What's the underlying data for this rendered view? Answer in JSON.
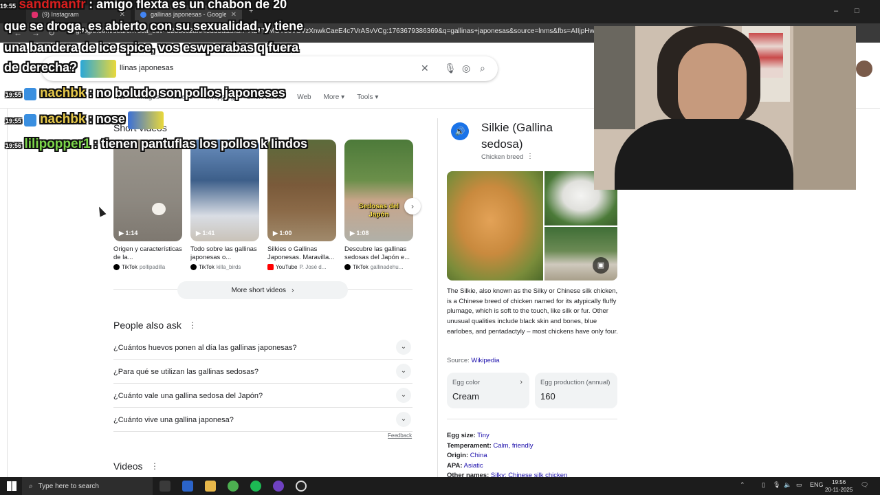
{
  "browser": {
    "tabs": [
      {
        "label": "(9) Instagram",
        "active": false
      },
      {
        "label": "gallinas japonesas - Google Se",
        "active": true
      }
    ],
    "url": "google.com/search?sca_esv=323dcc2af045d35a&sxsrf=AE3TifMOT50VSVzXnwkCaeE4c7VrASvVCg:1763679386369&q=gallinas+japonesas&source=lnms&fbs=AIIjpHw5jcGp5x8w5sPu",
    "new_tab": "+"
  },
  "search": {
    "query": "gallinas japonesas",
    "query_visible": "llinas japonesas",
    "filters": [
      "All",
      "Images",
      "Videos",
      "Shopping",
      "Short videos",
      "Web",
      "More",
      "Tools"
    ]
  },
  "short_videos": {
    "title": "Short videos",
    "more_label": "More short videos",
    "items": [
      {
        "duration": "1:14",
        "caption": "Origen y características de la...",
        "platform": "TikTok",
        "author": "pollipadilla",
        "color": "#000000"
      },
      {
        "duration": "1:41",
        "caption": "Todo sobre las gallinas japonesas o...",
        "platform": "TikTok",
        "author": "killa_birds",
        "color": "#000000"
      },
      {
        "duration": "1:00",
        "caption": "Silkies o Gallinas Japonesas. Maravilla...",
        "platform": "YouTube",
        "author": "P. José d...",
        "color": "#ff0000"
      },
      {
        "duration": "1:08",
        "caption": "Descubre las gallinas sedosas del Japón e...",
        "platform": "TikTok",
        "author": "gallinadehu...",
        "color": "#000000",
        "overlay_text": "Sedosas del Japón"
      }
    ]
  },
  "people_also_ask": {
    "title": "People also ask",
    "questions": [
      "¿Cuántos huevos ponen al día las gallinas japonesas?",
      "¿Para qué se utilizan las gallinas sedosas?",
      "¿Cuánto vale una gallina sedosa del Japón?",
      "¿Cuánto vive una gallina japonesa?"
    ],
    "feedback": "Feedback"
  },
  "videos_title": "Videos",
  "knowledge_panel": {
    "title": "Silkie (Gallina sedosa)",
    "subtitle": "Chicken breed",
    "description": "The Silkie, also known as the Silky or Chinese silk chicken, is a Chinese breed of chicken named for its atypically fluffy plumage, which is soft to the touch, like silk or fur. Other unusual qualities include black skin and bones, blue earlobes, and pentadactyly – most chickens have only four.",
    "source_label": "Source:",
    "source_link": "Wikipedia",
    "facts": [
      {
        "label": "Egg color",
        "value": "Cream"
      },
      {
        "label": "Egg production (annual)",
        "value": "160"
      }
    ],
    "attributes": [
      {
        "key": "Egg size:",
        "value": "Tiny"
      },
      {
        "key": "Temperament:",
        "value": "Calm, friendly"
      },
      {
        "key": "Origin:",
        "value": "China"
      },
      {
        "key": "APA:",
        "value": "Asiatic"
      },
      {
        "key": "Other names:",
        "value": "Silky; Chinese silk chicken"
      }
    ]
  },
  "chat": [
    {
      "time": "19:55",
      "user": "sandmanfr",
      "user_color": "#d81e1e",
      "message": ": amigo flexta es un chabon de 20"
    },
    {
      "time": "",
      "user": "",
      "user_color": "#ffffff",
      "message": "que se droga, es abierto con su sexualidad, y tiene"
    },
    {
      "time": "",
      "user": "",
      "user_color": "#ffffff",
      "message": "una bandera de ice spice, vos eswperabas q fuera"
    },
    {
      "time": "",
      "user": "",
      "user_color": "#ffffff",
      "message": "de derecha?"
    },
    {
      "time": "19:55",
      "user": "nachbk",
      "user_color": "#e6c84a",
      "message": ": no boludo son pollos japoneses"
    },
    {
      "time": "19:55",
      "user": "nachbk",
      "user_color": "#e6c84a",
      "message": ": nose"
    },
    {
      "time": "19:56",
      "user": "lilipopper1",
      "user_color": "#7cd64a",
      "message": ": tienen pantuflas los pollos k lindos"
    }
  ],
  "taskbar": {
    "search_placeholder": "Type here to search",
    "language": "ENG",
    "time": "19:56",
    "date": "20-11-2025"
  }
}
